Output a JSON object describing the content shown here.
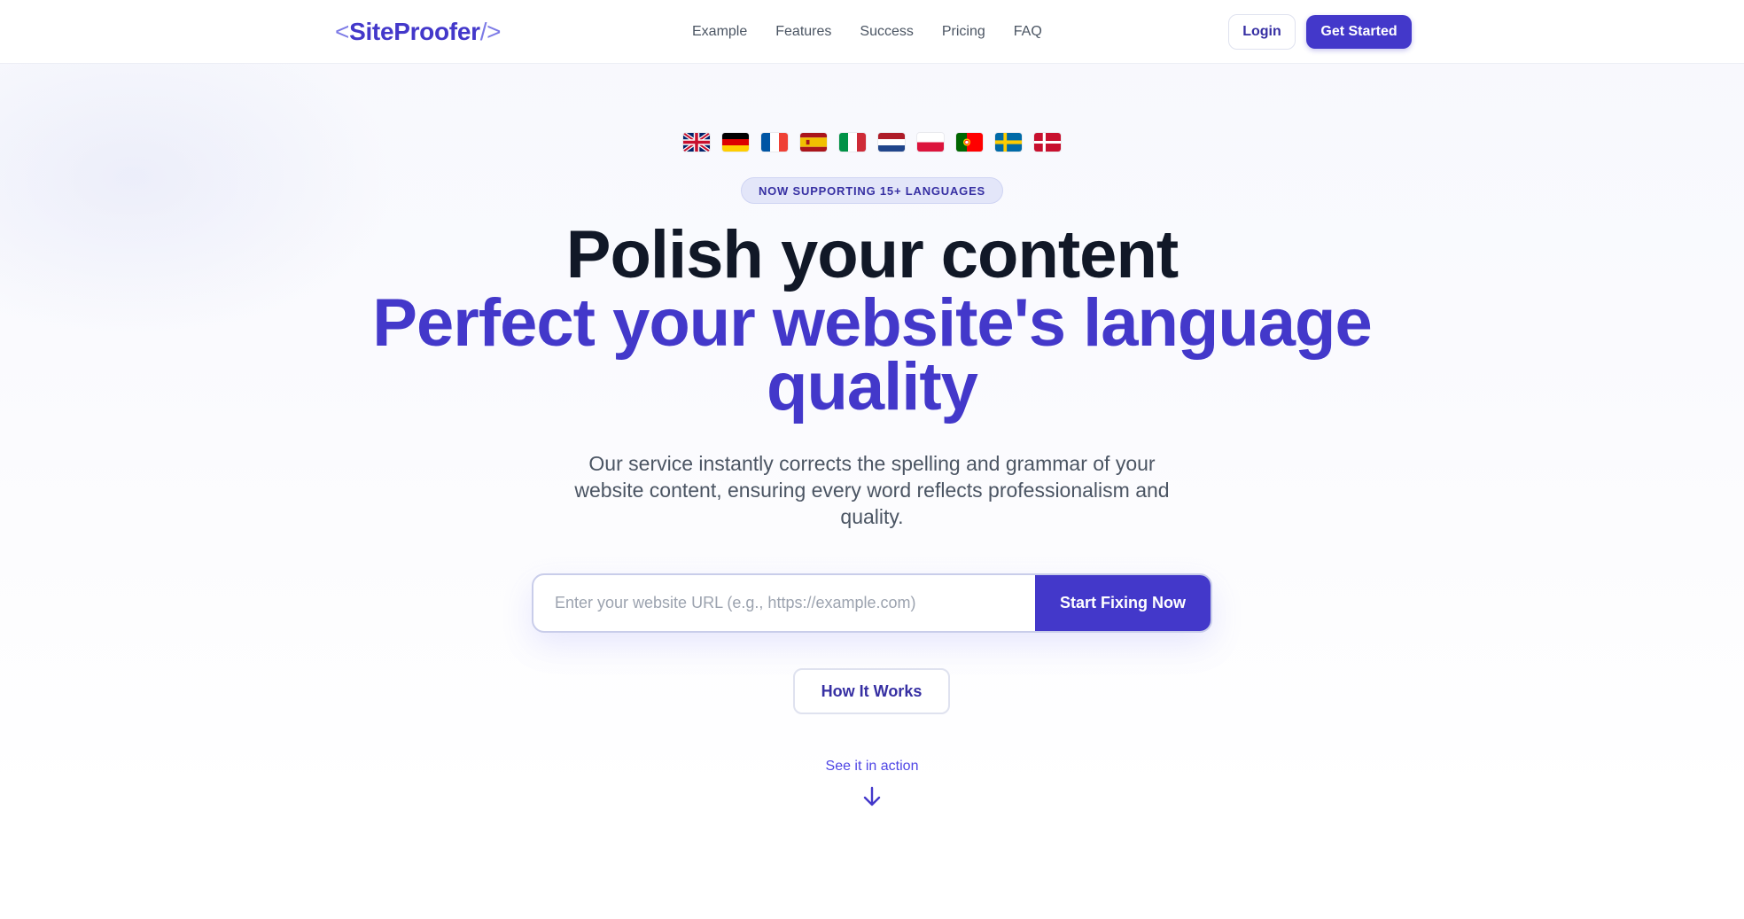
{
  "header": {
    "logo_open": "<",
    "logo_name": "SiteProofer",
    "logo_close": "/>",
    "nav": [
      "Example",
      "Features",
      "Success",
      "Pricing",
      "FAQ"
    ],
    "login_label": "Login",
    "get_started_label": "Get Started"
  },
  "hero": {
    "flags": [
      "uk-flag",
      "germany-flag",
      "france-flag",
      "spain-flag",
      "italy-flag",
      "netherlands-flag",
      "poland-flag",
      "portugal-flag",
      "sweden-flag",
      "denmark-flag"
    ],
    "badge": "NOW SUPPORTING 15+ LANGUAGES",
    "title_line1": "Polish your content",
    "title_line2": "Perfect your website's language quality",
    "subtitle": "Our service instantly corrects the spelling and grammar of your website content, ensuring every word reflects professionalism and quality.",
    "url_placeholder": "Enter your website URL (e.g., https://example.com)",
    "url_value": "",
    "cta_label": "Start Fixing Now",
    "how_label": "How It Works",
    "see_label": "See it in action"
  },
  "colors": {
    "brand": "#4338ca",
    "heading": "#111827",
    "text": "#4b5563"
  }
}
